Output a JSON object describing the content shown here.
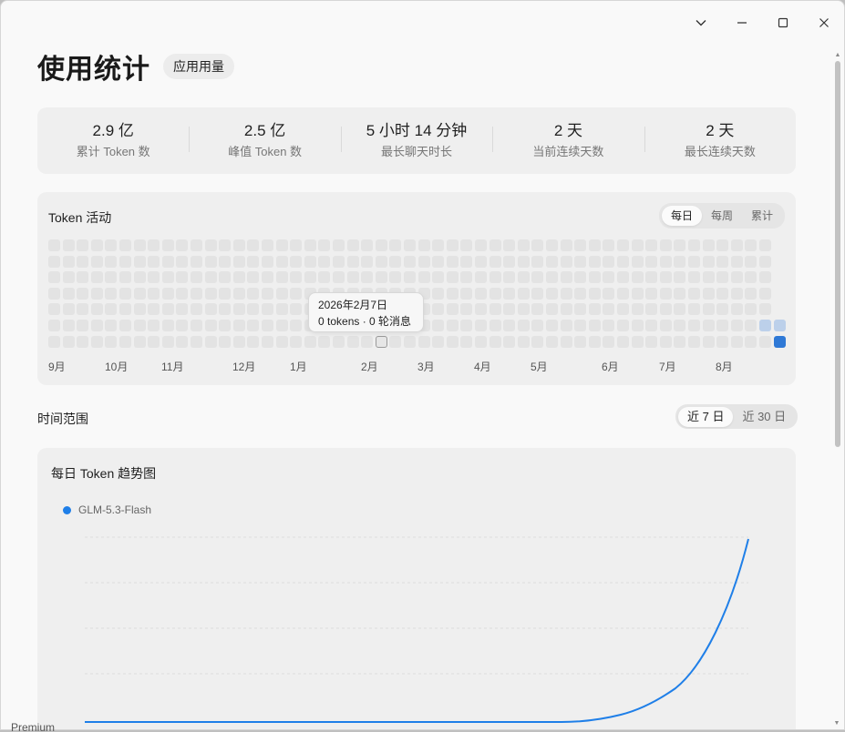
{
  "window": {
    "controls": [
      "chevron-down",
      "minimize",
      "maximize",
      "close"
    ]
  },
  "header": {
    "title": "使用统计",
    "chip": "应用用量"
  },
  "stats": [
    {
      "value": "2.9 亿",
      "label": "累计 Token 数"
    },
    {
      "value": "2.5 亿",
      "label": "峰值 Token 数"
    },
    {
      "value": "5 小时 14 分钟",
      "label": "最长聊天时长"
    },
    {
      "value": "2 天",
      "label": "当前连续天数"
    },
    {
      "value": "2 天",
      "label": "最长连续天数"
    }
  ],
  "activity": {
    "title": "Token 活动",
    "tabs": [
      "每日",
      "每周",
      "累计"
    ],
    "active_tab": "每日",
    "months": [
      "9月",
      "10月",
      "11月",
      "12月",
      "1月",
      "2月",
      "3月",
      "4月",
      "5月",
      "6月",
      "7月",
      "8月"
    ],
    "tooltip": {
      "date": "2026年2月7日",
      "detail": "0 tokens · 0 轮消息"
    }
  },
  "range": {
    "label": "时间范围",
    "options": [
      "近 7 日",
      "近 30 日"
    ],
    "active": "近 7 日"
  },
  "trend": {
    "title": "每日 Token 趋势图",
    "series_name": "GLM-5.3-Flash",
    "color": "#1f7fe8"
  },
  "footer_text": "Premium",
  "colors": {
    "accent": "#1f7fe8",
    "heat_high": "#2f79d6",
    "heat_low": "#bcd0ea"
  }
}
